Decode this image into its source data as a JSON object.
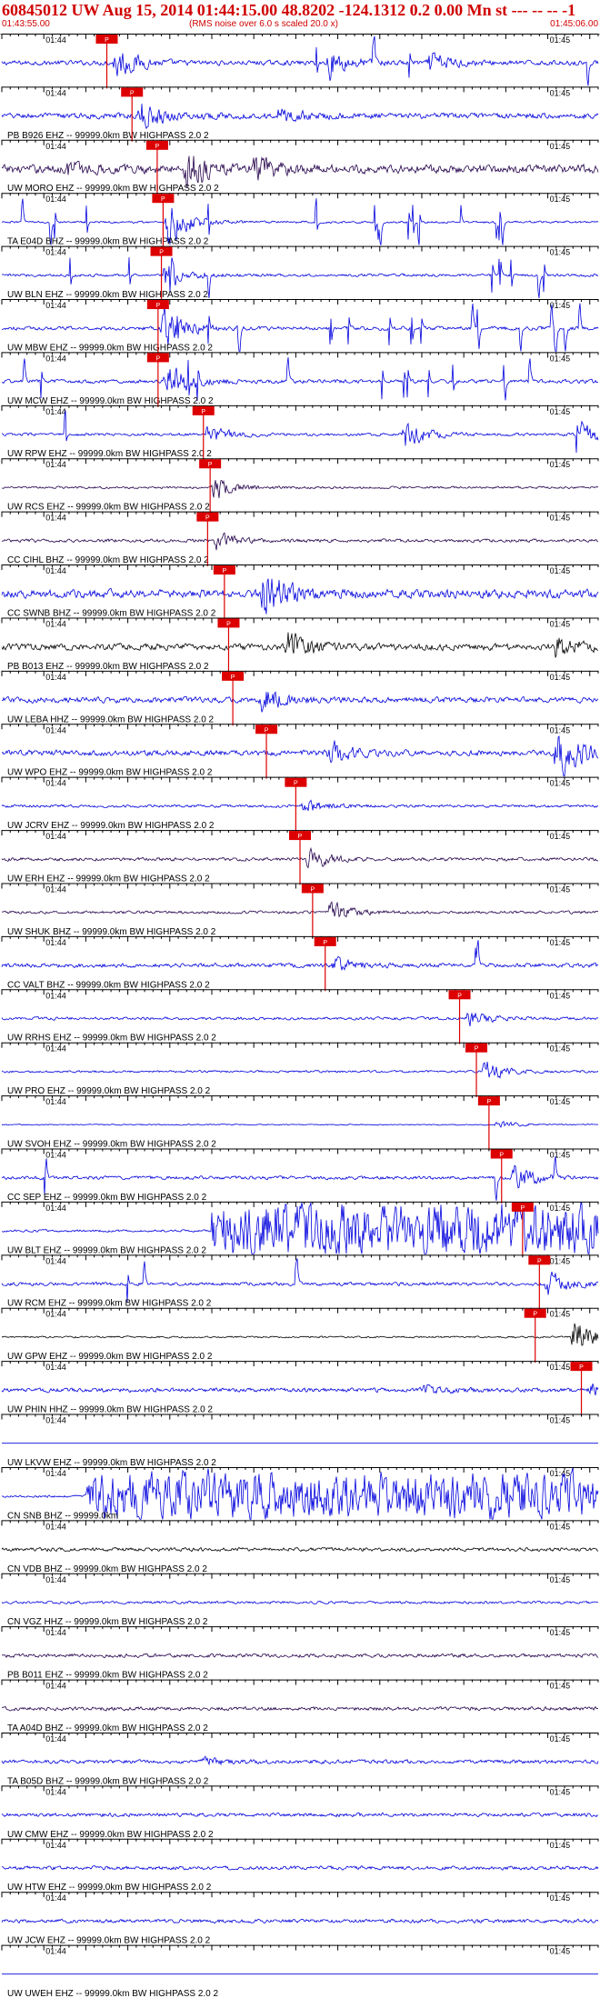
{
  "header": {
    "title": "60845012 UW Aug 15, 2014 01:44:15.00   48.8202 -124.1312  0.2 0.00 Mn st --- -- --   -1",
    "start_time": "01:43:55.00",
    "rms_note": "(RMS noise over 6.0 s scaled 20.0 x)",
    "end_time": "01:45:06.00"
  },
  "chart_data": {
    "type": "line",
    "title": "",
    "x_unit": "seconds after 01:43:55.00",
    "xlim": [
      0,
      71
    ],
    "tick_labels": {
      "left": "01:44",
      "right": "01:45"
    },
    "colors": {
      "blue": "#0000dd",
      "black": "#000000",
      "purple": "#22004a",
      "pick": "#dd0000",
      "axis": "#000000",
      "header_text": "#d00000"
    },
    "pick_label": "P",
    "traces": [
      {
        "label": "",
        "color": "blue",
        "amp": 0.25,
        "pick": 12.5,
        "events": [
          {
            "t": 13.5,
            "a": 2.0
          },
          {
            "t": 39,
            "a": 1.6
          },
          {
            "t": 51,
            "a": 1.2
          }
        ],
        "spikes": 4
      },
      {
        "label": "PB B926 EHZ -- 99999.0km BW  HIGHPASS  2.0  2",
        "color": "blue",
        "amp": 0.3,
        "pick": 15.5,
        "events": [
          {
            "t": 16.5,
            "a": 1.6
          },
          {
            "t": 33,
            "a": 0.9
          }
        ],
        "spikes": 0
      },
      {
        "label": "UW MORO EHZ -- 99999.0km BW  HIGHPASS  2.0  2",
        "color": "purple",
        "amp": 0.45,
        "pick": 18.5,
        "events": [
          {
            "t": 8,
            "a": 0.9
          },
          {
            "t": 22,
            "a": 2.4
          },
          {
            "t": 30,
            "a": 1.3
          }
        ],
        "spikes": 0
      },
      {
        "label": "TA E04D BHZ -- 99999.0km BW  HIGHPASS  2.0  2",
        "color": "blue",
        "amp": 0.12,
        "pick": 19.2,
        "events": [
          {
            "t": 19.8,
            "a": 2.8
          }
        ],
        "spikes": 18
      },
      {
        "label": "UW BLN EHZ -- 99999.0km BW  HIGHPASS  2.0  2",
        "color": "blue",
        "amp": 0.15,
        "pick": 19.0,
        "events": [
          {
            "t": 19.5,
            "a": 1.8
          }
        ],
        "spikes": 9
      },
      {
        "label": "UW MBW EHZ -- 99999.0km BW  HIGHPASS  2.0  2",
        "color": "blue",
        "amp": 0.2,
        "pick": 18.6,
        "events": [
          {
            "t": 19.2,
            "a": 2.2
          }
        ],
        "spikes": 16
      },
      {
        "label": "UW MCW EHZ -- 99999.0km BW  HIGHPASS  2.0  2",
        "color": "blue",
        "amp": 0.2,
        "pick": 18.6,
        "events": [
          {
            "t": 19.5,
            "a": 2.4
          }
        ],
        "spikes": 12
      },
      {
        "label": "UW RPW EHZ -- 99999.0km BW  HIGHPASS  2.0  2",
        "color": "blue",
        "amp": 0.15,
        "pick": 24.0,
        "events": [
          {
            "t": 24.5,
            "a": 1.0
          },
          {
            "t": 48,
            "a": 1.6
          },
          {
            "t": 69,
            "a": 1.2
          }
        ],
        "spikes": 2
      },
      {
        "label": "UW RCS EHZ -- 99999.0km BW  HIGHPASS  2.0  2",
        "color": "purple",
        "amp": 0.12,
        "pick": 24.8,
        "events": [
          {
            "t": 25.3,
            "a": 1.4
          }
        ],
        "spikes": 0
      },
      {
        "label": "CC CIHL BHZ -- 99999.0km BW  HIGHPASS  2.0  2",
        "color": "purple",
        "amp": 0.18,
        "pick": 24.5,
        "events": [
          {
            "t": 25.5,
            "a": 0.9
          }
        ],
        "spikes": 0
      },
      {
        "label": "CC SWNB BHZ -- 99999.0km BW  HIGHPASS  2.0  2",
        "color": "blue",
        "amp": 0.45,
        "pick": 26.5,
        "events": [
          {
            "t": 31,
            "a": 3.2
          }
        ],
        "spikes": 0
      },
      {
        "label": "PB B013 EHZ -- 99999.0km BW  HIGHPASS  2.0  2",
        "color": "black",
        "amp": 0.35,
        "pick": 27.0,
        "events": [
          {
            "t": 34,
            "a": 1.8
          },
          {
            "t": 66,
            "a": 1.3
          }
        ],
        "spikes": 0
      },
      {
        "label": "UW LEBA HHZ -- 99999.0km BW  HIGHPASS  2.0  2",
        "color": "blue",
        "amp": 0.3,
        "pick": 27.5,
        "events": [
          {
            "t": 31,
            "a": 1.5
          }
        ],
        "spikes": 0
      },
      {
        "label": "UW WPO EHZ -- 99999.0km BW  HIGHPASS  2.0  2",
        "color": "blue",
        "amp": 0.3,
        "pick": 31.5,
        "events": [
          {
            "t": 39,
            "a": 1.3
          },
          {
            "t": 66,
            "a": 3.5
          }
        ],
        "spikes": 0
      },
      {
        "label": "UW JCRV EHZ -- 99999.0km BW  HIGHPASS  2.0  2",
        "color": "blue",
        "amp": 0.15,
        "pick": 35.0,
        "events": [
          {
            "t": 36,
            "a": 0.8
          }
        ],
        "spikes": 0
      },
      {
        "label": "UW ERH EHZ -- 99999.0km BW  HIGHPASS  2.0  2",
        "color": "purple",
        "amp": 0.18,
        "pick": 35.5,
        "events": [
          {
            "t": 36.5,
            "a": 1.3
          }
        ],
        "spikes": 0
      },
      {
        "label": "UW SHUK BHZ -- 99999.0km BW  HIGHPASS  2.0  2",
        "color": "purple",
        "amp": 0.15,
        "pick": 37.0,
        "events": [
          {
            "t": 39,
            "a": 1.3
          }
        ],
        "spikes": 0
      },
      {
        "label": "CC VALT BHZ -- 99999.0km BW  HIGHPASS  2.0  2",
        "color": "blue",
        "amp": 0.22,
        "pick": 38.5,
        "events": [
          {
            "t": 39.5,
            "a": 0.8
          }
        ],
        "spikes": 2
      },
      {
        "label": "UW RRHS EHZ -- 99999.0km BW  HIGHPASS  2.0  2",
        "color": "blue",
        "amp": 0.15,
        "pick": 54.5,
        "events": [
          {
            "t": 55.5,
            "a": 0.8
          }
        ],
        "spikes": 0
      },
      {
        "label": "UW PRO EHZ -- 99999.0km BW  HIGHPASS  2.0  2",
        "color": "blue",
        "amp": 0.12,
        "pick": 56.5,
        "events": [
          {
            "t": 57.5,
            "a": 1.2
          }
        ],
        "spikes": 0
      },
      {
        "label": "UW SVOH EHZ -- 99999.0km BW  HIGHPASS  2.0  2",
        "color": "blue",
        "amp": 0.06,
        "pick": 58.0,
        "events": [
          {
            "t": 59,
            "a": 0.4
          }
        ],
        "spikes": 0
      },
      {
        "label": "CC SEP EHZ -- 99999.0km BW  HIGHPASS  2.0  2",
        "color": "blue",
        "amp": 0.18,
        "pick": 59.5,
        "events": [
          {
            "t": 61,
            "a": 1.4
          }
        ],
        "spikes": 3
      },
      {
        "label": "UW BLT EHZ -- 99999.0km BW  HIGHPASS  2.0  2",
        "color": "blue",
        "amp": 0.12,
        "pick": 62.0,
        "events": [],
        "spikes": 0,
        "burst": [
          25,
          71,
          2.8
        ]
      },
      {
        "label": "UW RCM EHZ -- 99999.0km BW  HIGHPASS  2.0  2",
        "color": "blue",
        "amp": 0.18,
        "pick": 64.0,
        "events": [
          {
            "t": 65,
            "a": 1.5
          }
        ],
        "spikes": 3
      },
      {
        "label": "UW GPW EHZ -- 99999.0km BW  HIGHPASS  2.0  2",
        "color": "black",
        "amp": 0.1,
        "pick": 63.5,
        "events": [
          {
            "t": 68,
            "a": 2.2
          }
        ],
        "spikes": 0
      },
      {
        "label": "UW PHIN HHZ -- 99999.0km BW  HIGHPASS  2.0  2",
        "color": "blue",
        "amp": 0.22,
        "pick": 69.0,
        "events": [
          {
            "t": 70,
            "a": 0.8
          },
          {
            "t": 50,
            "a": 0.7
          }
        ],
        "spikes": 0
      },
      {
        "label": "UW LKVW EHZ -- 99999.0km BW  HIGHPASS  2.0  2",
        "color": "blue",
        "amp": 0.0,
        "pick": null,
        "events": [],
        "spikes": 0
      },
      {
        "label": "CN SNB BHZ -- 99999.0km",
        "color": "blue",
        "amp": 0.12,
        "pick": null,
        "events": [],
        "spikes": 0,
        "burst": [
          10,
          71,
          2.4
        ]
      },
      {
        "label": "CN VDB BHZ -- 99999.0km BW  HIGHPASS  2.0  2",
        "color": "black",
        "amp": 0.2,
        "pick": null,
        "events": [],
        "spikes": 0
      },
      {
        "label": "CN VGZ HHZ -- 99999.0km BW  HIGHPASS  2.0  2",
        "color": "blue",
        "amp": 0.14,
        "pick": null,
        "events": [],
        "spikes": 0
      },
      {
        "label": "PB B011 EHZ -- 99999.0km BW  HIGHPASS  2.0  2",
        "color": "purple",
        "amp": 0.2,
        "pick": null,
        "events": [],
        "spikes": 0
      },
      {
        "label": "TA A04D BHZ -- 99999.0km BW  HIGHPASS  2.0  2",
        "color": "purple",
        "amp": 0.2,
        "pick": null,
        "events": [],
        "spikes": 0
      },
      {
        "label": "TA B05D BHZ -- 99999.0km BW  HIGHPASS  2.0  2",
        "color": "blue",
        "amp": 0.2,
        "pick": null,
        "events": [
          {
            "t": 24,
            "a": 0.6
          }
        ],
        "spikes": 0
      },
      {
        "label": "UW CMW EHZ -- 99999.0km BW  HIGHPASS  2.0  2",
        "color": "blue",
        "amp": 0.2,
        "pick": null,
        "events": [],
        "spikes": 0
      },
      {
        "label": "UW HTW EHZ -- 99999.0km BW  HIGHPASS  2.0  2",
        "color": "blue",
        "amp": 0.2,
        "pick": null,
        "events": [],
        "spikes": 0
      },
      {
        "label": "UW JCW EHZ -- 99999.0km BW  HIGHPASS  2.0  2",
        "color": "blue",
        "amp": 0.2,
        "pick": null,
        "events": [],
        "spikes": 0
      },
      {
        "label": "UW UWEH EHZ -- 99999.0km BW  HIGHPASS  2.0  2",
        "color": "blue",
        "amp": 0.0,
        "pick": null,
        "events": [],
        "spikes": 0
      }
    ]
  }
}
